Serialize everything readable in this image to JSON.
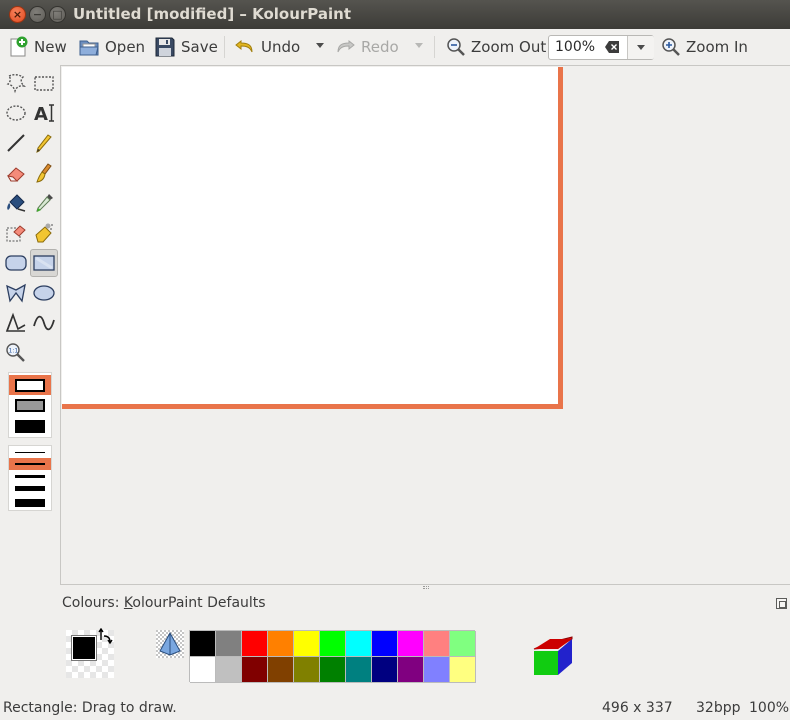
{
  "window": {
    "title": "Untitled [modified] – KolourPaint",
    "controls": {
      "close": "×",
      "minimize": "−",
      "maximize": "□"
    }
  },
  "toolbar": {
    "new_label": "New",
    "open_label": "Open",
    "save_label": "Save",
    "undo_label": "Undo",
    "redo_label": "Redo",
    "zoom_out_label": "Zoom Out",
    "zoom_value": "100%",
    "zoom_in_label": "Zoom In"
  },
  "tools": [
    {
      "name": "free-form-selection",
      "icon": "lasso-icon"
    },
    {
      "name": "rectangular-selection",
      "icon": "rect-select-icon"
    },
    {
      "name": "elliptical-selection",
      "icon": "ellipse-select-icon"
    },
    {
      "name": "text",
      "icon": "text-tool-icon",
      "glyph": "A"
    },
    {
      "name": "line",
      "icon": "line-tool-icon"
    },
    {
      "name": "pen",
      "icon": "pencil-icon"
    },
    {
      "name": "eraser",
      "icon": "eraser-icon"
    },
    {
      "name": "brush",
      "icon": "brush-icon"
    },
    {
      "name": "flood-fill",
      "icon": "paint-bucket-icon"
    },
    {
      "name": "color-picker",
      "icon": "eyedropper-icon"
    },
    {
      "name": "color-eraser",
      "icon": "color-eraser-icon"
    },
    {
      "name": "spraycan",
      "icon": "spraycan-icon"
    },
    {
      "name": "rounded-rectangle",
      "icon": "rounded-rect-icon"
    },
    {
      "name": "rectangle",
      "icon": "rectangle-icon",
      "selected": true
    },
    {
      "name": "polygon",
      "icon": "polygon-icon"
    },
    {
      "name": "ellipse",
      "icon": "ellipse-icon"
    },
    {
      "name": "connected-lines",
      "icon": "polyline-icon"
    },
    {
      "name": "curve",
      "icon": "curve-icon"
    },
    {
      "name": "zoom",
      "icon": "zoom-tool-icon",
      "glyph": "1:1"
    }
  ],
  "fill_styles": {
    "selected_index": 0
  },
  "line_widths": {
    "selected_index": 1
  },
  "canvas": {
    "resize_handle_color": "#e9744a"
  },
  "colour_panel": {
    "label_prefix": "Colours: ",
    "label_accel": "K",
    "label_rest": "olourPaint Defaults",
    "foreground": "#000000",
    "background": "#ffffff",
    "palette_row1": [
      "#000000",
      "#808080",
      "#ff0000",
      "#ff8000",
      "#ffff00",
      "#00ff00",
      "#00ffff",
      "#0000ff",
      "#ff00ff",
      "#ff8080",
      "#80ff80"
    ],
    "palette_row2": [
      "#ffffff",
      "#c0c0c0",
      "#800000",
      "#804000",
      "#808000",
      "#008000",
      "#008080",
      "#000080",
      "#800080",
      "#8080ff",
      "#ffff80"
    ]
  },
  "status": {
    "message": "Rectangle: Drag to draw.",
    "size": "496 x 337",
    "depth": "32bpp",
    "zoom": "100%"
  }
}
